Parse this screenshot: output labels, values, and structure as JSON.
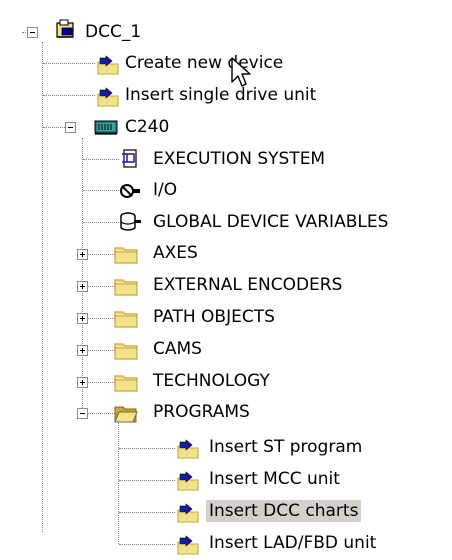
{
  "tree": {
    "root": {
      "label": "DCC_1",
      "icon": "project-icon",
      "expanded": true
    },
    "actions": [
      {
        "label": "Create new device",
        "icon": "folder-arrow-icon"
      },
      {
        "label": "Insert single drive unit",
        "icon": "folder-arrow-icon"
      }
    ],
    "device": {
      "label": "C240",
      "icon": "device-chip-icon",
      "expanded": true,
      "children": [
        {
          "label": "EXECUTION SYSTEM",
          "icon": "execution-system-icon"
        },
        {
          "label": "I/O",
          "icon": "io-icon"
        },
        {
          "label": "GLOBAL DEVICE VARIABLES",
          "icon": "database-icon"
        },
        {
          "label": "AXES",
          "icon": "folder-icon",
          "expanded": false
        },
        {
          "label": "EXTERNAL ENCODERS",
          "icon": "folder-icon",
          "expanded": false
        },
        {
          "label": "PATH OBJECTS",
          "icon": "folder-icon",
          "expanded": false
        },
        {
          "label": "CAMS",
          "icon": "folder-icon",
          "expanded": false
        },
        {
          "label": "TECHNOLOGY",
          "icon": "folder-icon",
          "expanded": false
        },
        {
          "label": "PROGRAMS",
          "icon": "folder-open-icon",
          "expanded": true
        }
      ]
    },
    "program_actions": [
      {
        "label": "Insert ST program",
        "icon": "folder-arrow-icon",
        "selected": false
      },
      {
        "label": "Insert MCC unit",
        "icon": "folder-arrow-icon",
        "selected": false
      },
      {
        "label": "Insert DCC charts",
        "icon": "folder-arrow-icon",
        "selected": true
      },
      {
        "label": "Insert LAD/FBD unit",
        "icon": "folder-arrow-icon",
        "selected": false
      }
    ]
  },
  "colors": {
    "folder": "#f5e08c",
    "folder_dark": "#c9a83a",
    "arrow": "#1a1aa8",
    "selection": "#d4d0c8",
    "chip": "#1f7a7a"
  }
}
